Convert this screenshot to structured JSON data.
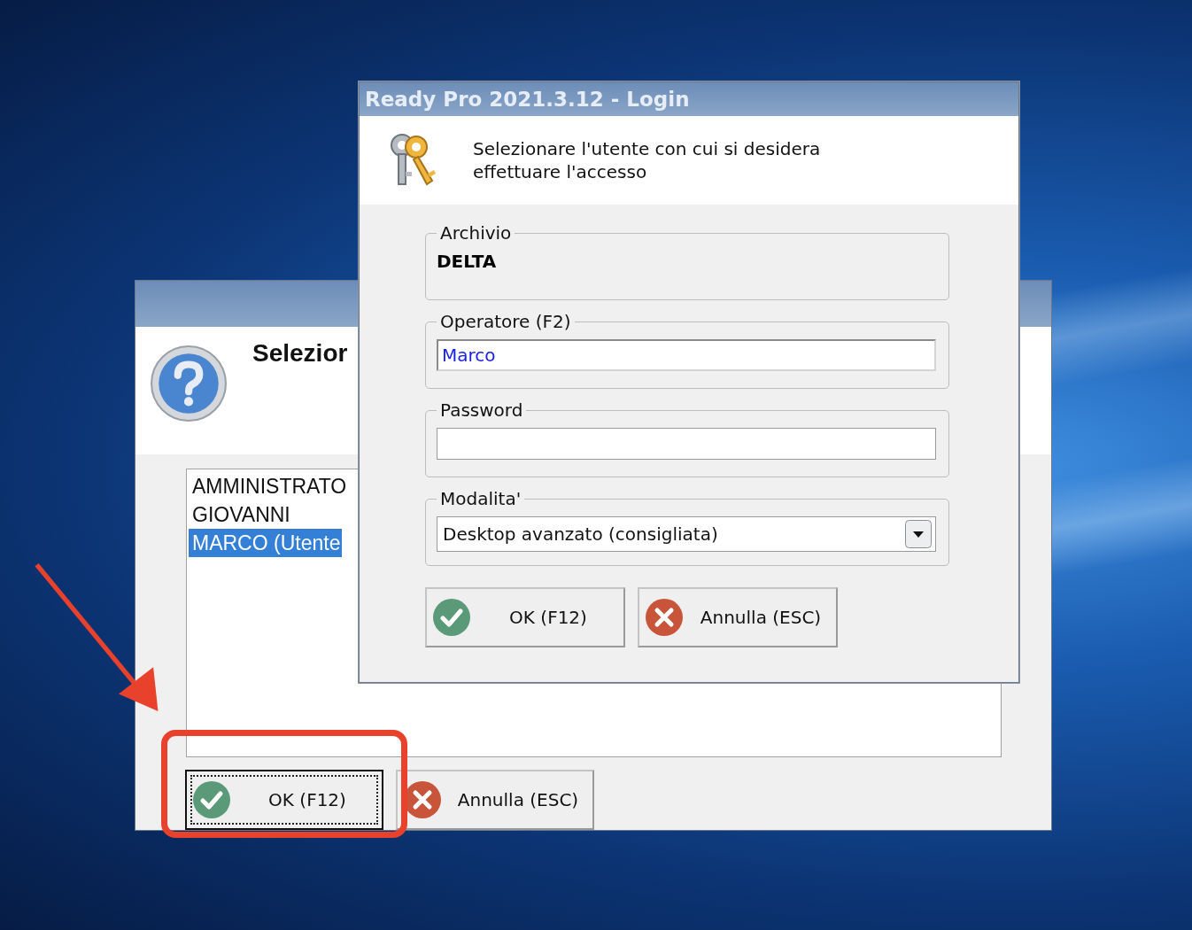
{
  "background_window": {
    "heading": "Selezior",
    "users": [
      {
        "name": "AMMINISTRATO",
        "selected": false
      },
      {
        "name": "GIOVANNI",
        "selected": false
      },
      {
        "name": "MARCO (Utente",
        "selected": true
      }
    ],
    "buttons": [
      {
        "label": "OK (F12)",
        "kind": "ok",
        "focused": true
      },
      {
        "label": "Annulla (ESC)",
        "kind": "cancel",
        "focused": false
      }
    ]
  },
  "login_window": {
    "title": "Ready Pro 2021.3.12 - Login",
    "message": "Selezionare l'utente con cui si desidera effettuare l'accesso",
    "archive": {
      "label": "Archivio",
      "value": "DELTA"
    },
    "operator": {
      "label": "Operatore (F2)",
      "value": "Marco"
    },
    "password": {
      "label": "Password"
    },
    "mode": {
      "label": "Modalita'",
      "value": "Desktop avanzato (consigliata)"
    },
    "buttons": [
      {
        "label": "OK (F12)",
        "kind": "ok",
        "focused": false
      },
      {
        "label": "Annulla (ESC)",
        "kind": "cancel",
        "focused": false
      }
    ]
  }
}
